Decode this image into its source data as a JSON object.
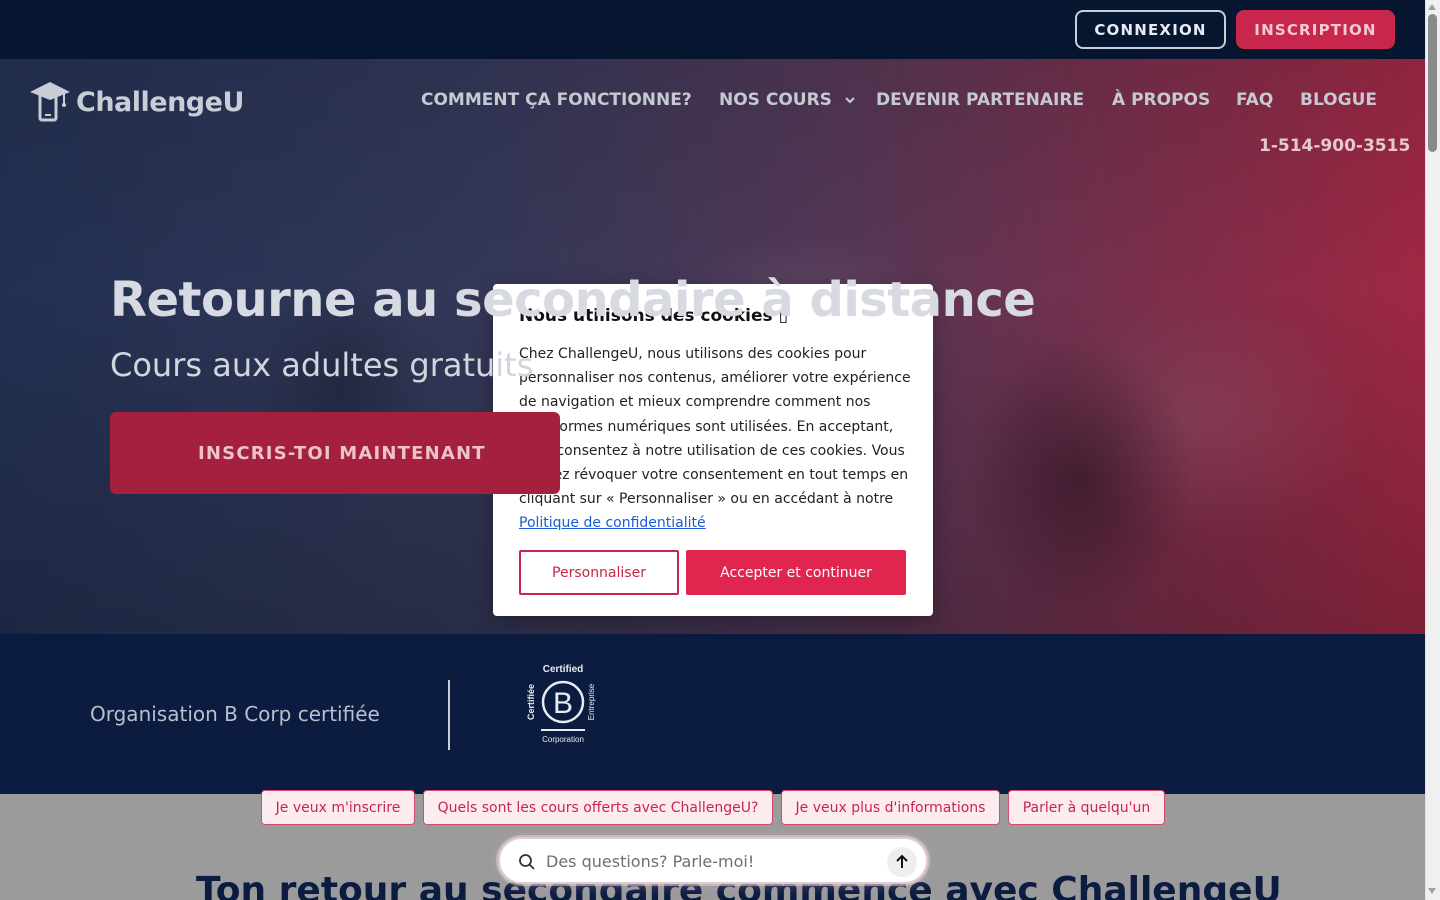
{
  "topbar": {
    "login_label": "CONNEXION",
    "signup_label": "INSCRIPTION"
  },
  "header": {
    "logo_text": "ChallengeU",
    "nav": [
      {
        "label": "COMMENT ÇA FONCTIONNE?"
      },
      {
        "label": "NOS COURS"
      },
      {
        "label": "DEVENIR PARTENAIRE"
      },
      {
        "label": "À PROPOS"
      },
      {
        "label": "FAQ"
      },
      {
        "label": "BLOGUE"
      }
    ],
    "phone": "1-514-900-3515"
  },
  "hero": {
    "title": "Retourne au secondaire à distance",
    "subtitle": "Cours aux adultes gratuits",
    "cta_label": "INSCRIS-TOI MAINTENANT"
  },
  "bcorp": {
    "text": "Organisation B Corp certifiée",
    "badge_top": "Certified",
    "badge_left": "Certifiée",
    "badge_right": "Entreprise",
    "badge_bottom": "Corporation",
    "badge_letter": "B"
  },
  "lower": {
    "title": "Ton retour au secondaire commence avec ChallengeU"
  },
  "chips": [
    {
      "label": "Je veux m'inscrire"
    },
    {
      "label": "Quels sont les cours offerts avec ChallengeU?"
    },
    {
      "label": "Je veux plus d'informations"
    },
    {
      "label": "Parler à quelqu'un"
    }
  ],
  "chat": {
    "placeholder": "Des questions? Parle-moi!"
  },
  "cookie": {
    "title": "Nous utilisons des cookies ▯",
    "body": "Chez ChallengeU, nous utilisons des cookies pour personnaliser nos contenus, améliorer votre expérience de navigation et mieux comprendre comment nos plateformes numériques sont utilisées. En acceptant, vous consentez à notre utilisation de ces cookies. Vous pouvez révoquer votre consentement en tout temps en cliquant sur « Personnaliser » ou en accédant à notre ",
    "link": "Politique de confidentialité",
    "customize_label": "Personnaliser",
    "accept_label": "Accepter et continuer"
  },
  "colors": {
    "brand": "#c8264a",
    "navy": "#0c1c40",
    "accept": "#e0264f"
  }
}
